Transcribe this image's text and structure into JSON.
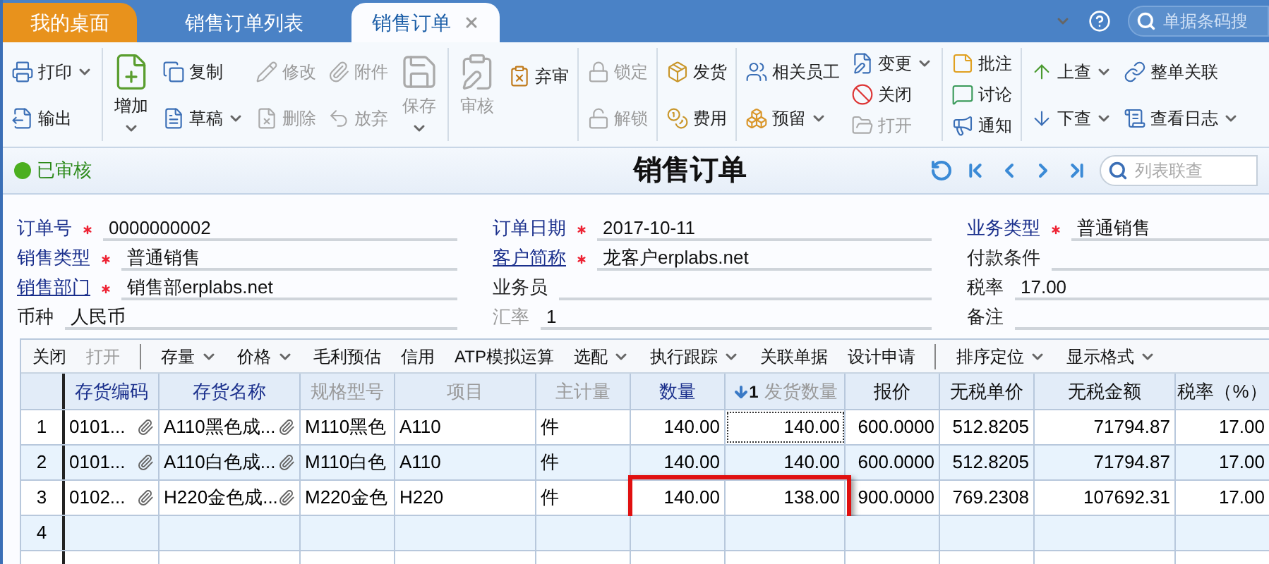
{
  "tabs": [
    {
      "label": "我的桌面",
      "kind": "home",
      "selected": false,
      "closable": false
    },
    {
      "label": "销售订单列表",
      "kind": "page",
      "selected": false,
      "closable": false
    },
    {
      "label": "销售订单",
      "kind": "page",
      "selected": true,
      "closable": true
    }
  ],
  "top_search": {
    "placeholder": "单据条码搜"
  },
  "toolbar": [
    [
      {
        "kind": "stack",
        "items": [
          {
            "label": "打印",
            "disabled": false,
            "dropdown": true
          },
          {
            "label": "输出",
            "disabled": false,
            "dropdown": false
          }
        ]
      }
    ],
    [
      {
        "kind": "large",
        "items": [
          {
            "label": "增加",
            "disabled": false,
            "dropdown": true
          }
        ]
      },
      {
        "kind": "stack",
        "items": [
          {
            "label": "复制",
            "disabled": false,
            "dropdown": false
          },
          {
            "label": "草稿",
            "disabled": false,
            "dropdown": true
          }
        ]
      },
      {
        "kind": "stack",
        "items": [
          {
            "label": "修改",
            "disabled": true,
            "dropdown": false
          },
          {
            "label": "删除",
            "disabled": true,
            "dropdown": false
          }
        ]
      },
      {
        "kind": "stack",
        "items": [
          {
            "label": "附件",
            "disabled": true,
            "dropdown": false
          },
          {
            "label": "放弃",
            "disabled": true,
            "dropdown": false
          }
        ]
      },
      {
        "kind": "large",
        "items": [
          {
            "label": "保存",
            "disabled": true,
            "dropdown": true
          }
        ]
      }
    ],
    [
      {
        "kind": "large",
        "items": [
          {
            "label": "审核",
            "disabled": true,
            "dropdown": false
          }
        ]
      },
      {
        "kind": "stack",
        "items": [
          {
            "label": "弃审",
            "disabled": false,
            "dropdown": false
          }
        ]
      }
    ],
    [
      {
        "kind": "stack",
        "items": [
          {
            "label": "锁定",
            "disabled": true,
            "dropdown": false
          },
          {
            "label": "解锁",
            "disabled": true,
            "dropdown": false
          }
        ]
      }
    ],
    [
      {
        "kind": "stack",
        "items": [
          {
            "label": "发货",
            "disabled": false,
            "dropdown": false
          },
          {
            "label": "费用",
            "disabled": false,
            "dropdown": false
          }
        ]
      }
    ],
    [
      {
        "kind": "stack",
        "items": [
          {
            "label": "相关员工",
            "disabled": false,
            "dropdown": false
          },
          {
            "label": "预留",
            "disabled": false,
            "dropdown": true
          }
        ]
      },
      {
        "kind": "stack",
        "items": [
          {
            "label": "变更",
            "disabled": false,
            "dropdown": true
          },
          {
            "label": "关闭",
            "disabled": false,
            "dropdown": false
          },
          {
            "label": "打开",
            "disabled": true,
            "dropdown": false
          }
        ]
      }
    ],
    [
      {
        "kind": "stack",
        "items": [
          {
            "label": "批注",
            "disabled": false,
            "dropdown": false
          },
          {
            "label": "讨论",
            "disabled": false,
            "dropdown": false
          },
          {
            "label": "通知",
            "disabled": false,
            "dropdown": false
          }
        ]
      }
    ],
    [
      {
        "kind": "stack",
        "items": [
          {
            "label": "上查",
            "disabled": false,
            "dropdown": true
          },
          {
            "label": "下查",
            "disabled": false,
            "dropdown": true
          }
        ]
      },
      {
        "kind": "stack",
        "items": [
          {
            "label": "整单关联",
            "disabled": false,
            "dropdown": false
          },
          {
            "label": "查看日志",
            "disabled": false,
            "dropdown": true
          }
        ]
      }
    ]
  ],
  "status": "已审核",
  "title": "销售订单",
  "list_search": {
    "placeholder": "列表联查"
  },
  "form": [
    [
      {
        "label": "订单号",
        "kind": "accent",
        "required": true,
        "value": "0000000002"
      },
      {
        "label": "销售类型",
        "kind": "accent",
        "required": true,
        "value": "普通销售"
      },
      {
        "label": "销售部门",
        "kind": "link",
        "required": true,
        "value": "销售部erplabs.net"
      },
      {
        "label": "币种",
        "kind": "plain",
        "required": false,
        "value": "人民币"
      }
    ],
    [
      {
        "label": "订单日期",
        "kind": "accent",
        "required": true,
        "value": "2017-10-11"
      },
      {
        "label": "客户简称",
        "kind": "link",
        "required": true,
        "value": "龙客户erplabs.net"
      },
      {
        "label": "业务员",
        "kind": "plain",
        "required": false
      },
      {
        "label": "汇率",
        "kind": "muted",
        "required": false,
        "value": "1"
      }
    ],
    [
      {
        "label": "业务类型",
        "kind": "accent",
        "required": true,
        "value": "普通销售"
      },
      {
        "label": "付款条件",
        "kind": "plain",
        "required": false
      },
      {
        "label": "税率",
        "kind": "plain",
        "required": false,
        "value": "17.00"
      },
      {
        "label": "备注",
        "kind": "plain",
        "required": false
      }
    ]
  ],
  "grid_toolbar": [
    {
      "kind": "button",
      "label": "关闭",
      "disabled": false,
      "dropdown": false
    },
    {
      "kind": "button",
      "label": "打开",
      "disabled": true,
      "dropdown": false
    },
    {
      "kind": "separator"
    },
    {
      "kind": "button",
      "label": "存量",
      "disabled": false,
      "dropdown": true
    },
    {
      "kind": "button",
      "label": "价格",
      "disabled": false,
      "dropdown": true
    },
    {
      "kind": "button",
      "label": "毛利预估",
      "disabled": false,
      "dropdown": false
    },
    {
      "kind": "button",
      "label": "信用",
      "disabled": false,
      "dropdown": false
    },
    {
      "kind": "button",
      "label": "ATP模拟运算",
      "disabled": false,
      "dropdown": false
    },
    {
      "kind": "button",
      "label": "选配",
      "disabled": false,
      "dropdown": true
    },
    {
      "kind": "button",
      "label": "执行跟踪",
      "disabled": false,
      "dropdown": true
    },
    {
      "kind": "button",
      "label": "关联单据",
      "disabled": false,
      "dropdown": false
    },
    {
      "kind": "button",
      "label": "设计申请",
      "disabled": false,
      "dropdown": false
    },
    {
      "kind": "separator"
    },
    {
      "kind": "button",
      "label": "排序定位",
      "disabled": false,
      "dropdown": true
    },
    {
      "kind": "button",
      "label": "显示格式",
      "disabled": false,
      "dropdown": true
    }
  ],
  "table": {
    "columns": [
      {
        "label": "存货编码",
        "kind": "required",
        "numeric": false,
        "attachment": true,
        "current": false
      },
      {
        "label": "存货名称",
        "kind": "required",
        "numeric": false,
        "attachment": true,
        "current": false
      },
      {
        "label": "规格型号",
        "kind": "readonly",
        "numeric": false,
        "attachment": false,
        "current": false
      },
      {
        "label": "项目",
        "kind": "readonly",
        "numeric": false,
        "attachment": false,
        "current": false
      },
      {
        "label": "主计量",
        "kind": "readonly",
        "numeric": false,
        "attachment": false,
        "current": false
      },
      {
        "label": "数量",
        "kind": "required",
        "numeric": true,
        "attachment": false,
        "current": false
      },
      {
        "label": "发货数量",
        "kind": "readonly",
        "numeric": true,
        "attachment": false,
        "current": true,
        "sort_mark": "1"
      },
      {
        "label": "报价",
        "kind": "normal",
        "numeric": true,
        "attachment": false,
        "current": false
      },
      {
        "label": "无税单价",
        "kind": "normal",
        "numeric": true,
        "attachment": false,
        "current": false
      },
      {
        "label": "无税金额",
        "kind": "normal",
        "numeric": true,
        "attachment": false,
        "current": false
      },
      {
        "label": "税率（%）",
        "kind": "normal",
        "numeric": true,
        "attachment": false,
        "current": false
      }
    ],
    "rows": [
      {
        "number": "1",
        "current": true,
        "highlighted": false,
        "cells": [
          "0101...",
          "A110黑色成...",
          "M110黑色",
          "A110",
          "件",
          "140.00",
          "140.00",
          "600.0000",
          "512.8205",
          "71794.87",
          "17.00"
        ]
      },
      {
        "number": "2",
        "current": false,
        "highlighted": false,
        "cells": [
          "0101...",
          "A110白色成...",
          "M110白色",
          "A110",
          "件",
          "140.00",
          "140.00",
          "600.0000",
          "512.8205",
          "71794.87",
          "17.00"
        ]
      },
      {
        "number": "3",
        "current": false,
        "highlighted": true,
        "cells": [
          "0102...",
          "H220金色成...",
          "M220金色",
          "H220",
          "件",
          "140.00",
          "138.00",
          "900.0000",
          "769.2308",
          "107692.31",
          "17.00"
        ]
      },
      {
        "number": "4",
        "current": false,
        "highlighted": false
      }
    ]
  }
}
